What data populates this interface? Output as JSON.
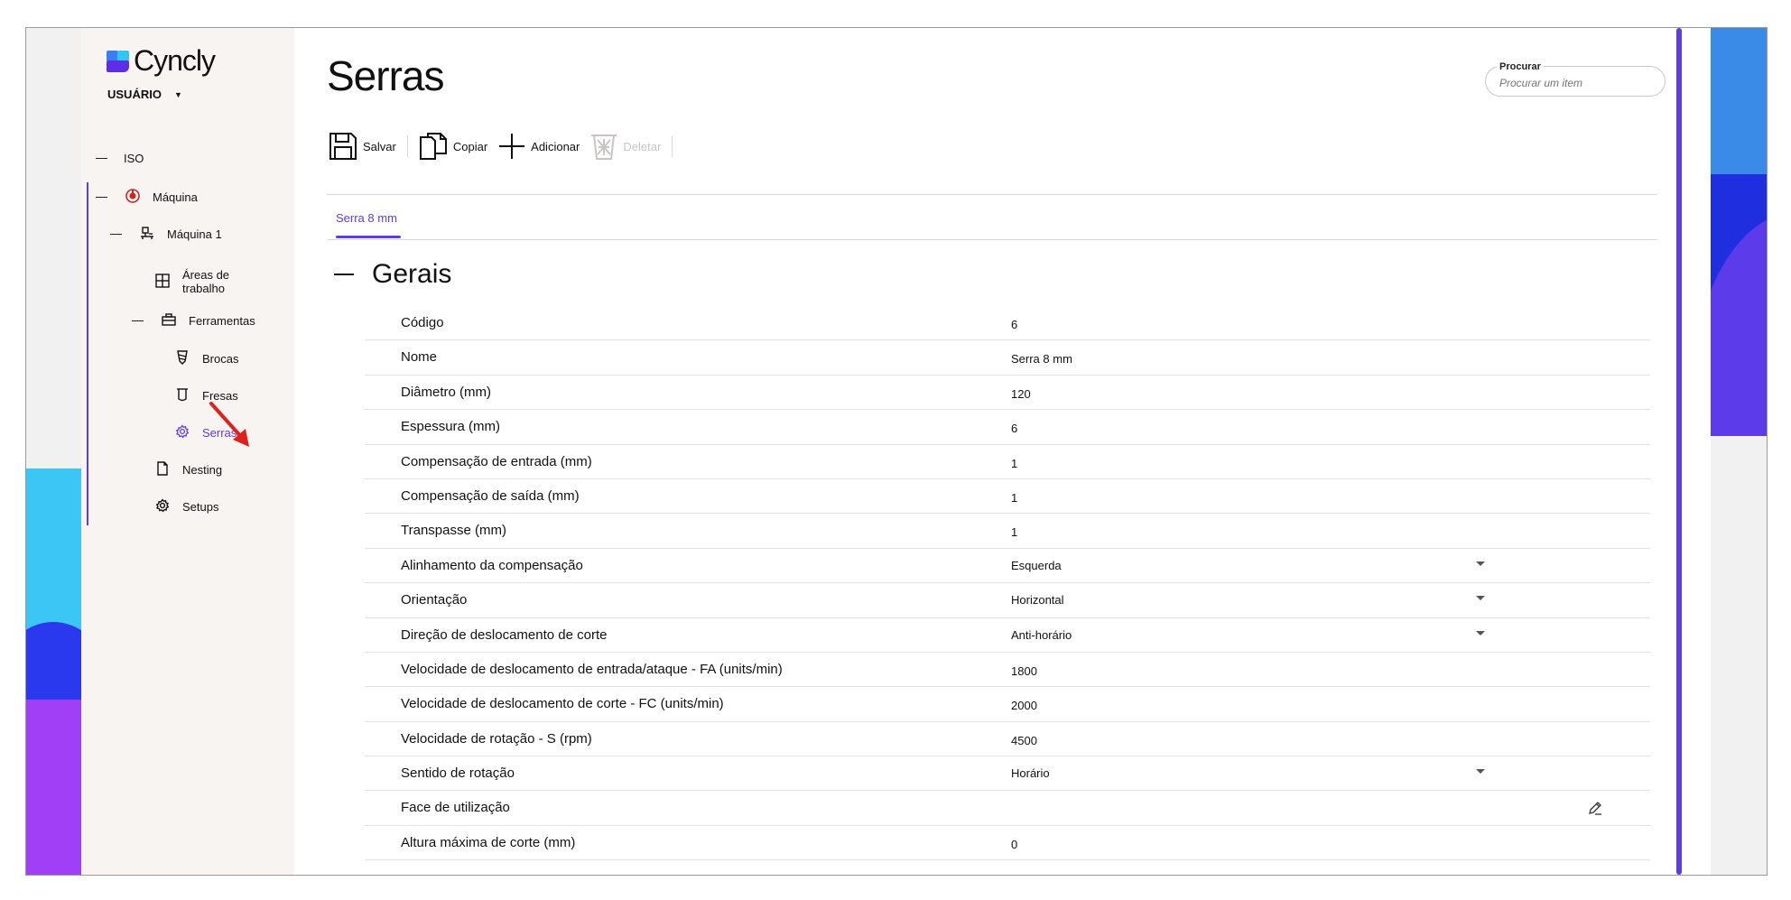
{
  "app": {
    "logo_text": "Cyncly",
    "user_label": "USUÁRIO"
  },
  "sidebar": {
    "items": [
      {
        "label": "ISO",
        "icon": "dash-icon"
      },
      {
        "label": "Máquina",
        "icon": "machine-icon"
      },
      {
        "label": "Máquina 1",
        "icon": "machine-unit-icon"
      },
      {
        "label": "Áreas de\ntrabalho",
        "icon": "grid-icon"
      },
      {
        "label": "Ferramentas",
        "icon": "toolbox-icon"
      },
      {
        "label": "Brocas",
        "icon": "drill-icon"
      },
      {
        "label": "Fresas",
        "icon": "mill-icon"
      },
      {
        "label": "Serras",
        "icon": "gear-icon",
        "active": true
      },
      {
        "label": "Nesting",
        "icon": "document-icon"
      },
      {
        "label": "Setups",
        "icon": "gear-icon"
      }
    ]
  },
  "header": {
    "title": "Serras",
    "search": {
      "label": "Procurar",
      "placeholder": "Procurar um item"
    }
  },
  "toolbar": {
    "save_label": "Salvar",
    "copy_label": "Copiar",
    "add_label": "Adicionar",
    "delete_label": "Deletar"
  },
  "tabs": [
    {
      "label": "Serra 8 mm",
      "active": true
    }
  ],
  "section": {
    "title": "Gerais"
  },
  "properties": [
    {
      "label": "Código",
      "value": "6"
    },
    {
      "label": "Nome",
      "value": "Serra 8 mm"
    },
    {
      "label": "Diâmetro (mm)",
      "value": "120"
    },
    {
      "label": "Espessura (mm)",
      "value": "6"
    },
    {
      "label": "Compensação de entrada (mm)",
      "value": "1"
    },
    {
      "label": "Compensação de saída (mm)",
      "value": "1"
    },
    {
      "label": "Transpasse (mm)",
      "value": "1"
    },
    {
      "label": "Alinhamento da compensação",
      "value": "Esquerda",
      "type": "select"
    },
    {
      "label": "Orientação",
      "value": "Horizontal",
      "type": "select"
    },
    {
      "label": "Direção de deslocamento de corte",
      "value": "Anti-horário",
      "type": "select"
    },
    {
      "label": "Velocidade de deslocamento de entrada/ataque - FA (units/min)",
      "value": "1800"
    },
    {
      "label": "Velocidade de deslocamento de corte - FC (units/min)",
      "value": "2000"
    },
    {
      "label": "Velocidade de rotação - S (rpm)",
      "value": "4500"
    },
    {
      "label": "Sentido de rotação",
      "value": "Horário",
      "type": "select"
    },
    {
      "label": "Face de utilização",
      "value": "",
      "type": "edit"
    },
    {
      "label": "Altura máxima de corte (mm)",
      "value": "0"
    }
  ],
  "colors": {
    "accent": "#5b3bea",
    "sidebar_bg": "#f7f4f1",
    "annotation_arrow": "#e0201c"
  }
}
